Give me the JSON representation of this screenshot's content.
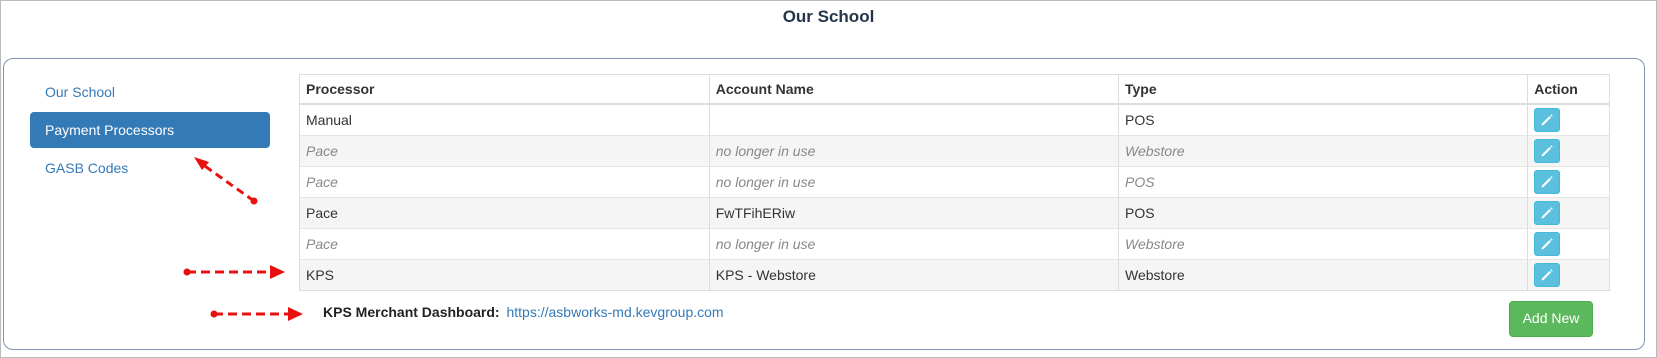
{
  "page": {
    "title": "Our School"
  },
  "sidebar": {
    "items": [
      {
        "label": "Our School",
        "active": false
      },
      {
        "label": "Payment Processors",
        "active": true
      },
      {
        "label": "GASB Codes",
        "active": false
      }
    ]
  },
  "table": {
    "headers": [
      "Processor",
      "Account Name",
      "Type",
      "Action"
    ],
    "rows": [
      {
        "processor": "Manual",
        "account": "",
        "type": "POS",
        "inactive": false
      },
      {
        "processor": "Pace",
        "account": "no longer in use",
        "type": "Webstore",
        "inactive": true
      },
      {
        "processor": "Pace",
        "account": "no longer in use",
        "type": "POS",
        "inactive": true
      },
      {
        "processor": "Pace",
        "account": "FwTFihERiw",
        "type": "POS",
        "inactive": false
      },
      {
        "processor": "Pace",
        "account": "no longer in use",
        "type": "Webstore",
        "inactive": true
      },
      {
        "processor": "KPS",
        "account": "KPS - Webstore",
        "type": "Webstore",
        "inactive": false
      }
    ],
    "action_icon": "pencil-icon"
  },
  "merchant": {
    "label": "KPS Merchant Dashboard:",
    "url": "https://asbworks-md.kevgroup.com"
  },
  "buttons": {
    "add_new": "Add New"
  },
  "colors": {
    "primary": "#337ab7",
    "success": "#5cb85c",
    "info": "#5bc0de",
    "annotation": "#e8110f"
  }
}
